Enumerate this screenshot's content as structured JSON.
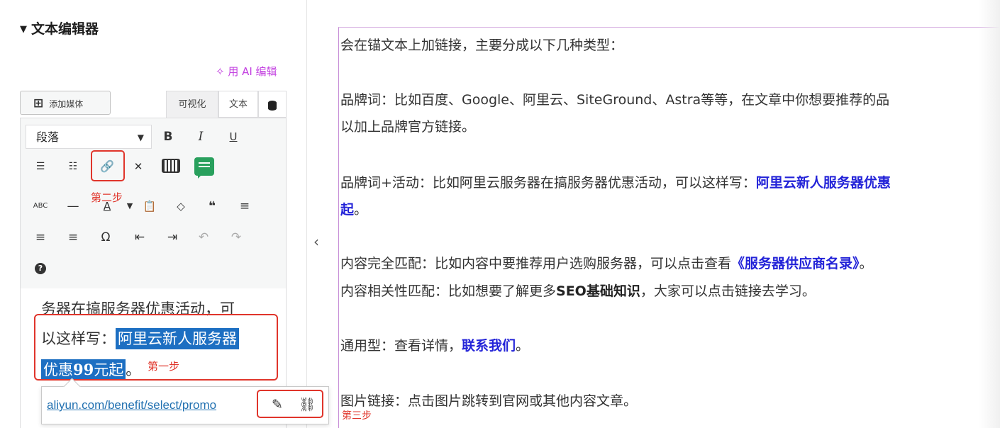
{
  "sidebar": {
    "section_title": "文本编辑器",
    "ai_edit": "✧ 用 AI 编辑",
    "add_media": "添加媒体",
    "tabs": {
      "visual": "可视化",
      "text": "文本"
    },
    "format_select": "段落",
    "toolbar_glyphs": {
      "bold": "B",
      "italic": "I",
      "underline": "U",
      "ul": "☰",
      "ol": "☷",
      "link": "🔗",
      "fullscreen": "✕",
      "strike": "ABC",
      "hr": "—",
      "textcolor": "A",
      "paste": "📋",
      "clear": "◇",
      "quote": "❝",
      "align_left": "≡",
      "align_center": "≡",
      "align_right": "≡",
      "omega": "Ω",
      "outdent": "⇤",
      "indent": "⇥",
      "undo": "↶",
      "redo": "↷",
      "help": "?"
    },
    "step_two": "第二步",
    "editor": {
      "line1": "务器在搞服务器优惠活动，可",
      "line2_prefix": "以这样写：",
      "line2_highlight": "阿里云新人服务器",
      "line3_highlight_a": "优惠",
      "line3_highlight_b": "99",
      "line3_highlight_c": "元起",
      "line3_suffix": "。",
      "step_one": "第一步"
    },
    "link_popup": {
      "url": "aliyun.com/benefit/select/promo",
      "edit_glyph": "✎",
      "unlink_glyph": "⛓",
      "step_three": "第三步"
    },
    "collapse_glyph": "‹"
  },
  "preview": {
    "p1": "会在锚文本上加链接，主要分成以下几种类型：",
    "p2a": "品牌词：比如百度、Google、阿里云、SiteGround、Astra等等，在文章中你想要推荐的品",
    "p2b": "以加上品牌官方链接。",
    "p3a_prefix": "品牌词+活动：比如阿里云服务器在搞服务器优惠活动，可以这样写：",
    "p3a_link": "阿里云新人服务器优惠",
    "p3b_link": "起",
    "p3b_suffix": "。",
    "p4_prefix": "内容完全匹配：比如内容中要推荐用户选购服务器，可以点击查看",
    "p4_link": "《服务器供应商名录》",
    "p4_suffix": "。",
    "p5_prefix": "内容相关性匹配：比如想要了解更多",
    "p5_bold": "SEO基础知识",
    "p5_suffix": "，大家可以点击链接去学习。",
    "p6_prefix": "通用型：查看详情，",
    "p6_link": "联系我们",
    "p6_suffix": "。",
    "p7": "图片链接：点击图片跳转到官网或其他内容文章。"
  },
  "colors": {
    "highlight": "#1d6fc2",
    "annotation_red": "#e0352b",
    "link_blue": "#2323d8",
    "ai_purple": "#c23fe0"
  }
}
